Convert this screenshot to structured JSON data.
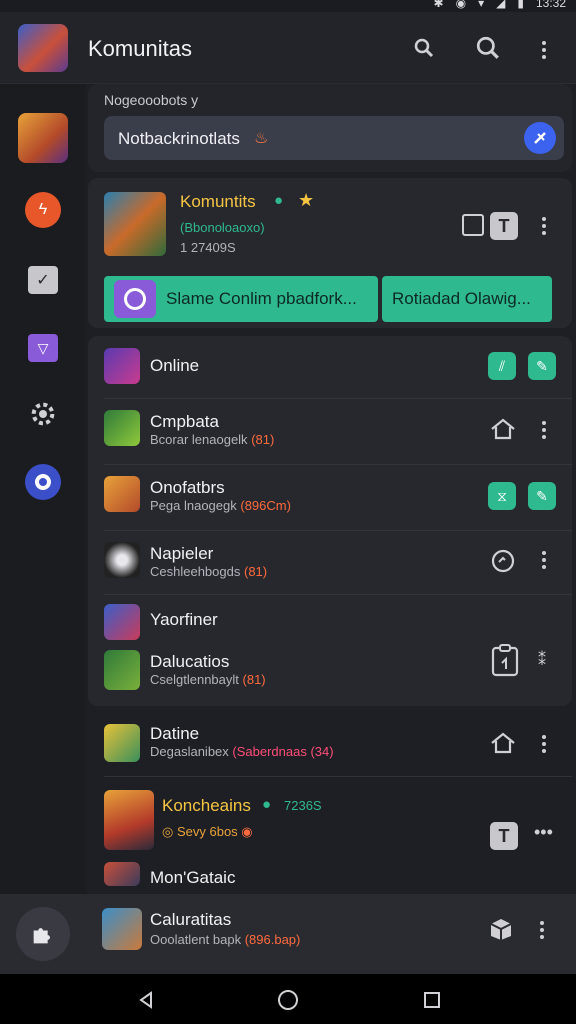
{
  "status": {
    "time": "13:32"
  },
  "appbar": {
    "title": "Komunitas"
  },
  "search": {
    "label": "Nogeooobots y",
    "value": "Notbackrinotlats"
  },
  "featured": {
    "title": "Komuntits",
    "subtitle": "(Bbonoloaoxo)",
    "meta": "1 27409S",
    "primary_action": "Slame Conlim pbadfork...",
    "secondary_action": "Rotiadad Olawig..."
  },
  "rows": [
    {
      "title": "Online",
      "sub": "",
      "accent": ""
    },
    {
      "title": "Cmpbata",
      "sub": "Bcorar lenaogelk",
      "accent": "(81)"
    },
    {
      "title": "Onofatbrs",
      "sub": "Pega lnaogegk",
      "accent": "(896Cm)"
    },
    {
      "title": "Napieler",
      "sub": "Ceshleehbogds",
      "accent": "(81)"
    },
    {
      "title": "Yaorfiner",
      "sub": "",
      "accent": ""
    },
    {
      "title": "Dalucatios",
      "sub": "Cselgtlennbaylt",
      "accent": "(81)"
    },
    {
      "title": "Datine",
      "sub": "Degaslanibex",
      "accent": "(Saberdnaas (34)"
    },
    {
      "title": "Koncheains",
      "sub": "Sevy 6bos",
      "accent": "7236S"
    },
    {
      "title": "Mon'Gataic",
      "sub": "",
      "accent": ""
    },
    {
      "title": "Caluratitas",
      "sub": "Ooolatlent bapk",
      "accent": "(896.bap)"
    }
  ],
  "colors": {
    "accent_green": "#2fb98e",
    "accent_blue": "#3b63f0",
    "accent_orange": "#ff6a3d",
    "gold": "#f5c542"
  },
  "icons": [
    "search-icon",
    "more-vert-icon",
    "send-icon",
    "home-icon",
    "gear-icon",
    "puzzle-icon"
  ]
}
